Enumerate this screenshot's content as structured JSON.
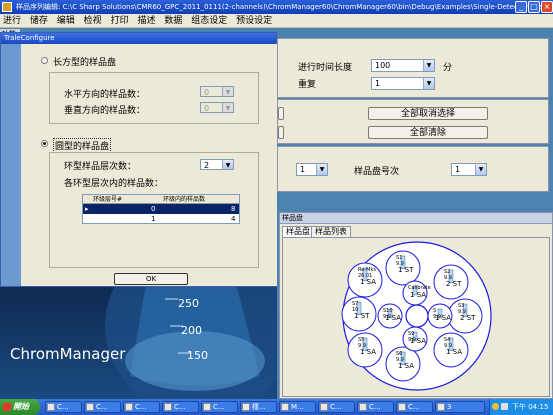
{
  "titlebar": {
    "title": "样品序列编辑: C:\\C Sharp Solutions\\CMR60_GPC_2011_0111(2-channels)\\ChromManager60\\ChromManager60\\bin\\Debug\\Examples\\Single-Detector-Example_1*"
  },
  "menu": [
    "进行",
    "储存",
    "编辑",
    "检视",
    "打印",
    "描述",
    "数据",
    "组态设定",
    "预设设定"
  ],
  "left_pane": {
    "label": "功能",
    "label2": "功能"
  },
  "bg_form": {
    "run_length_label": "进行时间长度",
    "run_length_value": "100",
    "run_length_unit": "分",
    "repeat_label": "重复",
    "repeat_value": "1",
    "deselect_all": "全部取消选择",
    "clear_all": "全部清除",
    "combo1_value": "1",
    "tray_no_label": "样品盘号次",
    "tray_no_value": "1"
  },
  "dialog": {
    "title": "TraleConfigure",
    "rect_label": "长方型的样品盘",
    "horiz_label": "水平方向的样品数：",
    "horiz_value": "0",
    "vert_label": "垂直方向的样品数：",
    "vert_value": "0",
    "circle_label": "圆型的样品盘",
    "rings_label": "环型样品层次数：",
    "rings_value": "2",
    "per_ring_label": "各环型层次内的样品数：",
    "grid_headers": [
      "环级层号#",
      "环级内的样品数"
    ],
    "grid_rows": [
      [
        "0",
        "8"
      ],
      [
        "1",
        "4"
      ]
    ],
    "ok": "OK"
  },
  "tray_panel": {
    "title": "样品盘",
    "tabs": [
      "样品盘",
      "样品列表"
    ],
    "slots": [
      {
        "name": "S1",
        "num": "9.9",
        "id": "1",
        "tag": "ST"
      },
      {
        "name": "S2",
        "num": "9.9",
        "id": "2",
        "tag": "ST"
      },
      {
        "name": "S3",
        "num": "9.9",
        "id": "2",
        "tag": "ST"
      },
      {
        "name": "S4",
        "num": "9.9",
        "id": "1",
        "tag": "SA"
      },
      {
        "name": "S5",
        "num": "9.9",
        "id": "1",
        "tag": "SA"
      },
      {
        "name": "S6",
        "num": "9.9",
        "id": "1",
        "tag": "SA"
      },
      {
        "name": "S7",
        "num": "10",
        "id": "1",
        "tag": "ST"
      },
      {
        "name": "Re-Mks",
        "num": "26.01",
        "id": "1",
        "tag": "SA"
      }
    ],
    "inner_slots": [
      {
        "name": "Calibrate",
        "num": "",
        "id": "1",
        "tag": "SA"
      },
      {
        "name": "S",
        "num": "9.9",
        "id": "1",
        "tag": "SA"
      },
      {
        "name": "S9",
        "num": "9.9",
        "id": "1",
        "tag": "SA"
      },
      {
        "name": "S10",
        "num": "9.9",
        "id": "1",
        "tag": "SA"
      }
    ]
  },
  "splash": {
    "brand": "ChromManager",
    "scale": [
      "250",
      "200",
      "150"
    ]
  },
  "taskbar": {
    "start": "開始",
    "items": [
      "C...",
      "C...",
      "C...",
      "C...",
      "C...",
      "樣...",
      "M...",
      "C...",
      "C...",
      "C...",
      "3"
    ],
    "clock": "下午 04:15"
  }
}
